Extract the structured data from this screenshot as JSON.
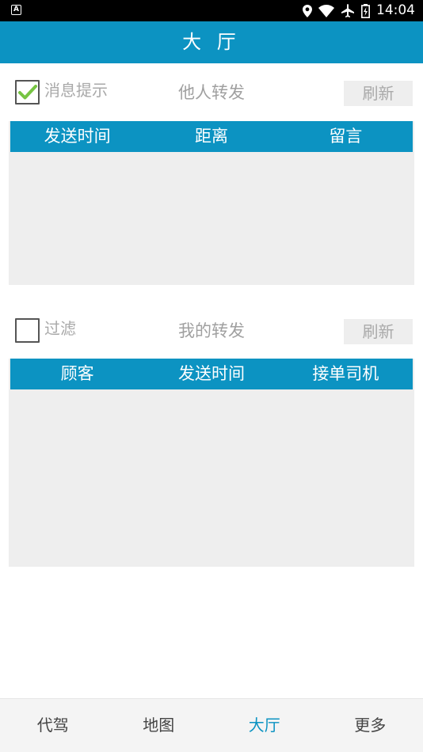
{
  "status_bar": {
    "time": "14:04"
  },
  "header": {
    "title": "大 厅"
  },
  "section1": {
    "checkbox_label": "消息提示",
    "checkbox_checked": true,
    "title": "他人转发",
    "refresh_label": "刷新",
    "columns": [
      "发送时间",
      "距离",
      "留言"
    ]
  },
  "section2": {
    "checkbox_label": "过滤",
    "checkbox_checked": false,
    "title": "我的转发",
    "refresh_label": "刷新",
    "columns": [
      "顾客",
      "发送时间",
      "接单司机"
    ]
  },
  "tabs": [
    {
      "label": "代驾",
      "active": false
    },
    {
      "label": "地图",
      "active": false
    },
    {
      "label": "大厅",
      "active": true
    },
    {
      "label": "更多",
      "active": false
    }
  ],
  "colors": {
    "primary": "#0c93c2",
    "check": "#76c442",
    "panel": "#eeeeee"
  }
}
